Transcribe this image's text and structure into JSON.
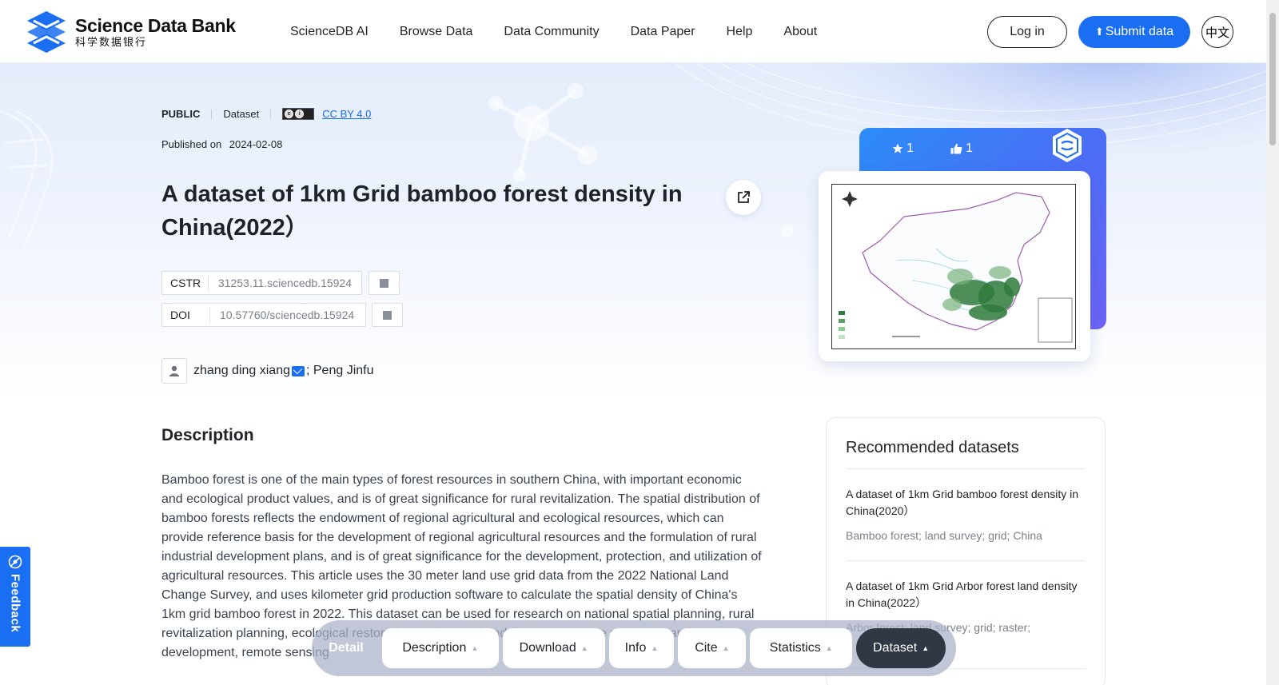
{
  "header": {
    "logo_en": "Science Data Bank",
    "logo_cn": "科学数据银行",
    "nav": [
      "ScienceDB AI",
      "Browse Data",
      "Data Community",
      "Data Paper",
      "Help",
      "About"
    ],
    "login_label": "Log in",
    "submit_label": "Submit data",
    "lang_label": "中文"
  },
  "dataset": {
    "access": "PUBLIC",
    "type": "Dataset",
    "license": "CC BY 4.0",
    "published_label": "Published on",
    "published_date": "2024-02-08",
    "title": "A dataset of 1km Grid bamboo forest density in China(2022）",
    "cstr_label": "CSTR",
    "cstr_value": "31253.11.sciencedb.15924",
    "doi_label": "DOI",
    "doi_value": "10.57760/sciencedb.15924",
    "author_1": "zhang ding xiang",
    "author_2": "; Peng Jinfu",
    "stars": "1",
    "likes": "1"
  },
  "description": {
    "heading": "Description",
    "text": "Bamboo forest is one of the main types of forest resources in southern China, with important economic and ecological product values, and is of great significance for rural revitalization. The spatial distribution of bamboo forests reflects the endowment of regional agricultural and ecological resources, which can provide reference basis for the development of regional agricultural resources and the formulation of rural industrial development plans, and is of great significance for the development, protection, and utilization of agricultural resources. This article uses the 30 meter land use grid data from the 2022 National Land Change Survey, and uses kilometer grid production software to calculate the spatial density of China's 1km grid bamboo forest in 2022. This dataset can be used for research on national spatial planning, rural revitalization planning, ecological restoration, agricultural and forestry resource protection and development, remote sensing"
  },
  "recommended": {
    "heading": "Recommended datasets",
    "items": [
      {
        "title": "A dataset of 1km Grid bamboo forest density in China(2020）",
        "tags": "Bamboo forest; land survey; grid; China"
      },
      {
        "title": "A dataset of 1km Grid Arbor forest land density in China(2022）",
        "tags": "Arbor forest; land survey; grid; raster;"
      }
    ]
  },
  "feedback_label": "Feedback",
  "tabbar": {
    "label": "Detail",
    "tabs": [
      "Description",
      "Download",
      "Info",
      "Cite",
      "Statistics",
      "Dataset"
    ],
    "active": "Dataset"
  },
  "colors": {
    "primary": "#1a6ef2",
    "card_gradient_start": "#2c8cf8",
    "card_gradient_end": "#6d63f4",
    "tab_active": "#303745"
  },
  "icons": [
    "star-icon",
    "thumbs-up-icon",
    "share-icon",
    "copy-icon",
    "user-icon",
    "mail-icon",
    "feedback-icon",
    "upload-icon",
    "chevron-up-icon"
  ]
}
